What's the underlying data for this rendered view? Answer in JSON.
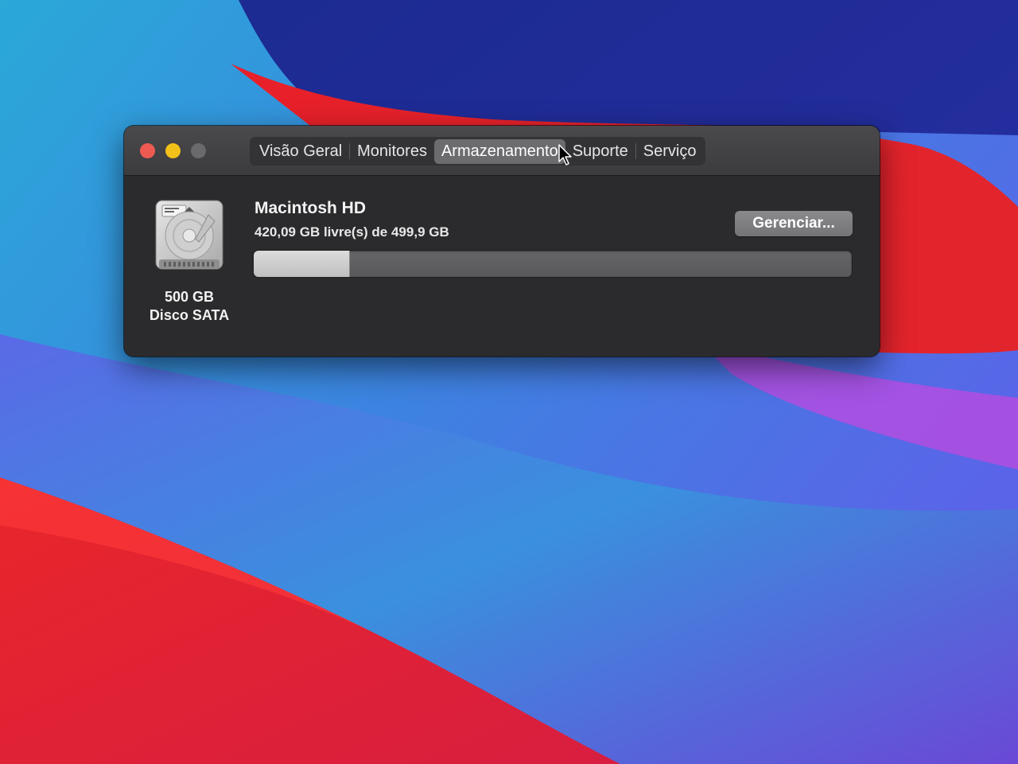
{
  "window": {
    "tabs": [
      {
        "label": "Visão Geral"
      },
      {
        "label": "Monitores"
      },
      {
        "label": "Armazenamento",
        "active": true
      },
      {
        "label": "Suporte"
      },
      {
        "label": "Serviço"
      }
    ]
  },
  "storage": {
    "disk_size": "500 GB",
    "disk_type": "Disco SATA",
    "volume_name": "Macintosh HD",
    "free_text": "420,09 GB livre(s) de 499,9 GB",
    "manage_label": "Gerenciar...",
    "used_fraction": 0.16
  },
  "colors": {
    "close": "#ee5a52",
    "minimize": "#f3c21a",
    "zoom": "#6a696c",
    "window_bg": "#2b2a2c"
  },
  "icons": [
    "close-icon",
    "minimize-icon",
    "zoom-icon",
    "hard-disk-icon",
    "mouse-pointer-icon"
  ]
}
